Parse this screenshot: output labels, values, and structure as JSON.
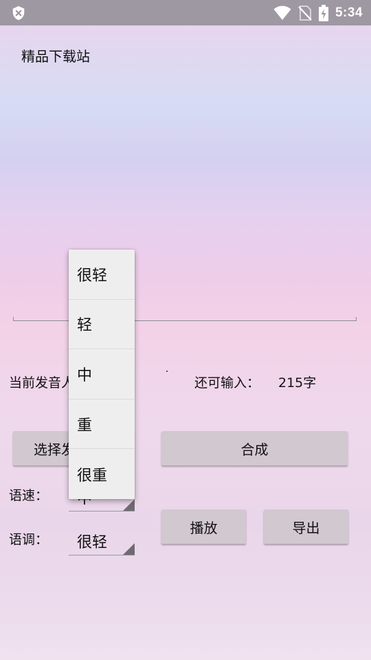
{
  "status_bar": {
    "time": "5:34",
    "icons": [
      "shield-x-icon",
      "wifi-icon",
      "no-sim-icon",
      "battery-charging-icon"
    ]
  },
  "header": {
    "title": "精品下载站"
  },
  "form": {
    "current_voice_label": "当前发音人",
    "remaining_label": "还可输入：",
    "remaining_count": "215字",
    "select_voice_button": "选择发音人",
    "synthesize_button": "合成",
    "speed_label": "语速：",
    "speed_value": "中",
    "tone_label": "语调：",
    "tone_value": "很轻",
    "play_button": "播放",
    "export_button": "导出"
  },
  "dropdown": {
    "options": [
      "很轻",
      "轻",
      "中",
      "重",
      "很重"
    ]
  }
}
